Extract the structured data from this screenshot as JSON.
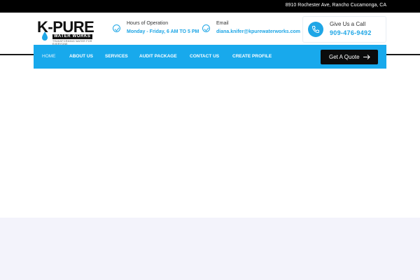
{
  "topbar": {
    "address": "8910 Rochester Ave, Rancho Cucamonga, CA"
  },
  "logo": {
    "title": "K-PURE",
    "subtitle": "WATER WORKS",
    "tagline": "TRANSFORMING WATER FOR EVERYONE"
  },
  "hours": {
    "label": "Hours of Operation",
    "value": "Monday - Friday, 6 AM TO 5 PM",
    "icon": "check-circle-icon"
  },
  "email": {
    "label": "Email",
    "value": "diana.knifer@kpurewaterworks.com",
    "icon": "check-circle-icon"
  },
  "call": {
    "label": "Give Us a Call",
    "phone": "909-476-9492",
    "icon": "phone-icon"
  },
  "nav": {
    "items": [
      {
        "label": "HOME",
        "active": true
      },
      {
        "label": "ABOUT US"
      },
      {
        "label": "SERVICES"
      },
      {
        "label": "AUDIT PACKAGE"
      },
      {
        "label": "CONTACT US"
      },
      {
        "label": "CREATE PROFILE"
      }
    ],
    "cta": "Get A Quote"
  },
  "colors": {
    "accent": "#18a9ec",
    "dark": "#0b0b0b",
    "band": "#f3f3fb"
  }
}
